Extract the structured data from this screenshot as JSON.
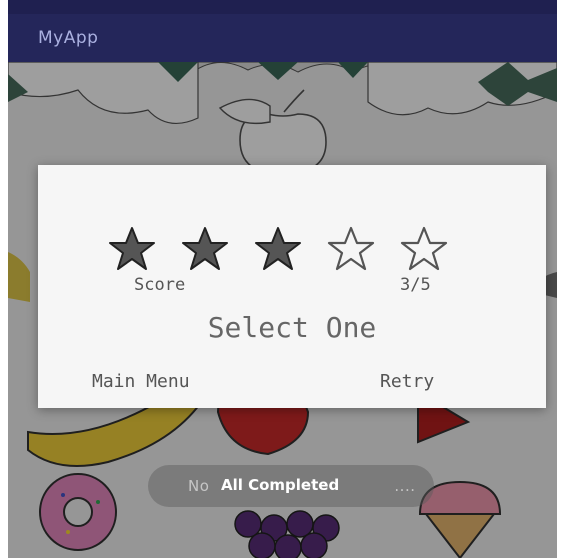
{
  "app": {
    "title": "MyApp"
  },
  "dialog": {
    "stars_filled": 3,
    "stars_total": 5,
    "score_label": "Score",
    "score_value": "3/5",
    "title": "Select One",
    "main_menu_label": "Main Menu",
    "retry_label": "Retry"
  },
  "toast": {
    "background_text": "No",
    "background_text_tail": "....",
    "foreground_text": "All Completed"
  },
  "colors": {
    "app_bar": "#24265a",
    "status_bar": "#1f2050",
    "dialog_bg": "#f6f6f6",
    "star_fill": "#555555",
    "star_outline": "#555555"
  },
  "icons": {
    "star_filled": "filled-star-icon",
    "star_empty": "empty-star-icon"
  }
}
